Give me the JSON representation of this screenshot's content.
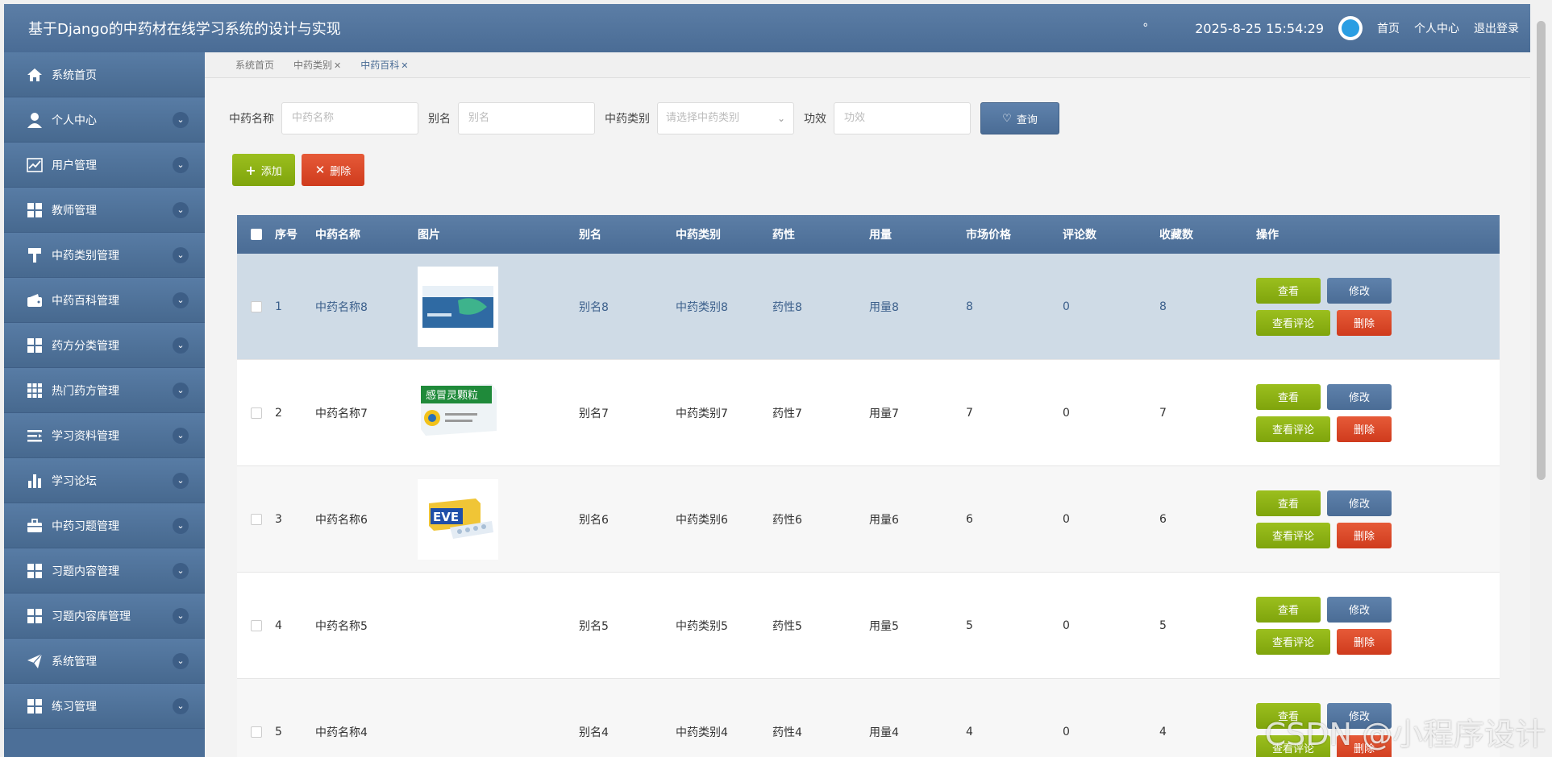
{
  "header": {
    "title": "基于Django的中药材在线学习系统的设计与实现",
    "mark": "°",
    "datetime": "2025-8-25 15:54:29",
    "links": [
      "首页",
      "个人中心",
      "退出登录"
    ]
  },
  "sidebar": {
    "items": [
      {
        "label": "系统首页",
        "icon": "home-icon",
        "expandable": false
      },
      {
        "label": "个人中心",
        "icon": "user-icon",
        "expandable": true
      },
      {
        "label": "用户管理",
        "icon": "chart-icon",
        "expandable": true
      },
      {
        "label": "教师管理",
        "icon": "grid-icon",
        "expandable": true
      },
      {
        "label": "中药类别管理",
        "icon": "brush-icon",
        "expandable": true
      },
      {
        "label": "中药百科管理",
        "icon": "wallet-icon",
        "expandable": true
      },
      {
        "label": "药方分类管理",
        "icon": "grid-icon",
        "expandable": true
      },
      {
        "label": "热门药方管理",
        "icon": "apps-icon",
        "expandable": true
      },
      {
        "label": "学习资料管理",
        "icon": "list-icon",
        "expandable": true
      },
      {
        "label": "学习论坛",
        "icon": "bar-chart-icon",
        "expandable": true
      },
      {
        "label": "中药习题管理",
        "icon": "briefcase-icon",
        "expandable": true
      },
      {
        "label": "习题内容管理",
        "icon": "grid-icon",
        "expandable": true
      },
      {
        "label": "习题内容库管理",
        "icon": "grid-icon",
        "expandable": true
      },
      {
        "label": "系统管理",
        "icon": "send-icon",
        "expandable": true
      },
      {
        "label": "练习管理",
        "icon": "grid-icon",
        "expandable": true
      }
    ]
  },
  "tabs": [
    {
      "label": "系统首页",
      "closable": false,
      "active": false
    },
    {
      "label": "中药类别",
      "closable": true,
      "active": false
    },
    {
      "label": "中药百科",
      "closable": true,
      "active": true
    }
  ],
  "search": {
    "name_label": "中药名称",
    "name_placeholder": "中药名称",
    "alias_label": "别名",
    "alias_placeholder": "别名",
    "category_label": "中药类别",
    "category_placeholder": "请选择中药类别",
    "effect_label": "功效",
    "effect_placeholder": "功效",
    "query_label": "查询"
  },
  "toolbar": {
    "add_label": "添加",
    "delete_label": "删除"
  },
  "table": {
    "columns": [
      "序号",
      "中药名称",
      "图片",
      "别名",
      "中药类别",
      "药性",
      "用量",
      "市场价格",
      "评论数",
      "收藏数",
      "操作"
    ],
    "row_actions": {
      "view": "查看",
      "edit": "修改",
      "comments": "查看评论",
      "delete": "删除"
    },
    "rows": [
      {
        "no": "1",
        "name": "中药名称8",
        "image": "medicine-box-blue",
        "alias": "别名8",
        "category": "中药类别8",
        "nature": "药性8",
        "dosage": "用量8",
        "price": "8",
        "comments": "0",
        "favorites": "8"
      },
      {
        "no": "2",
        "name": "中药名称7",
        "image": "medicine-box-green",
        "alias": "别名7",
        "category": "中药类别7",
        "nature": "药性7",
        "dosage": "用量7",
        "price": "7",
        "comments": "0",
        "favorites": "7"
      },
      {
        "no": "3",
        "name": "中药名称6",
        "image": "medicine-box-eve",
        "alias": "别名6",
        "category": "中药类别6",
        "nature": "药性6",
        "dosage": "用量6",
        "price": "6",
        "comments": "0",
        "favorites": "6"
      },
      {
        "no": "4",
        "name": "中药名称5",
        "image": "",
        "alias": "别名5",
        "category": "中药类别5",
        "nature": "药性5",
        "dosage": "用量5",
        "price": "5",
        "comments": "0",
        "favorites": "5"
      },
      {
        "no": "5",
        "name": "中药名称4",
        "image": "",
        "alias": "别名4",
        "category": "中药类别4",
        "nature": "药性4",
        "dosage": "用量4",
        "price": "4",
        "comments": "0",
        "favorites": "4"
      }
    ]
  },
  "image_text": {
    "green_box": "感冒灵颗粒",
    "eve_box": "EVE"
  },
  "watermark": "CSDN @小程序设计",
  "colors": {
    "primary": "#4a6c95",
    "green": "#8bb214",
    "red": "#dc4526",
    "highlight_row": "#cfdbe6"
  }
}
